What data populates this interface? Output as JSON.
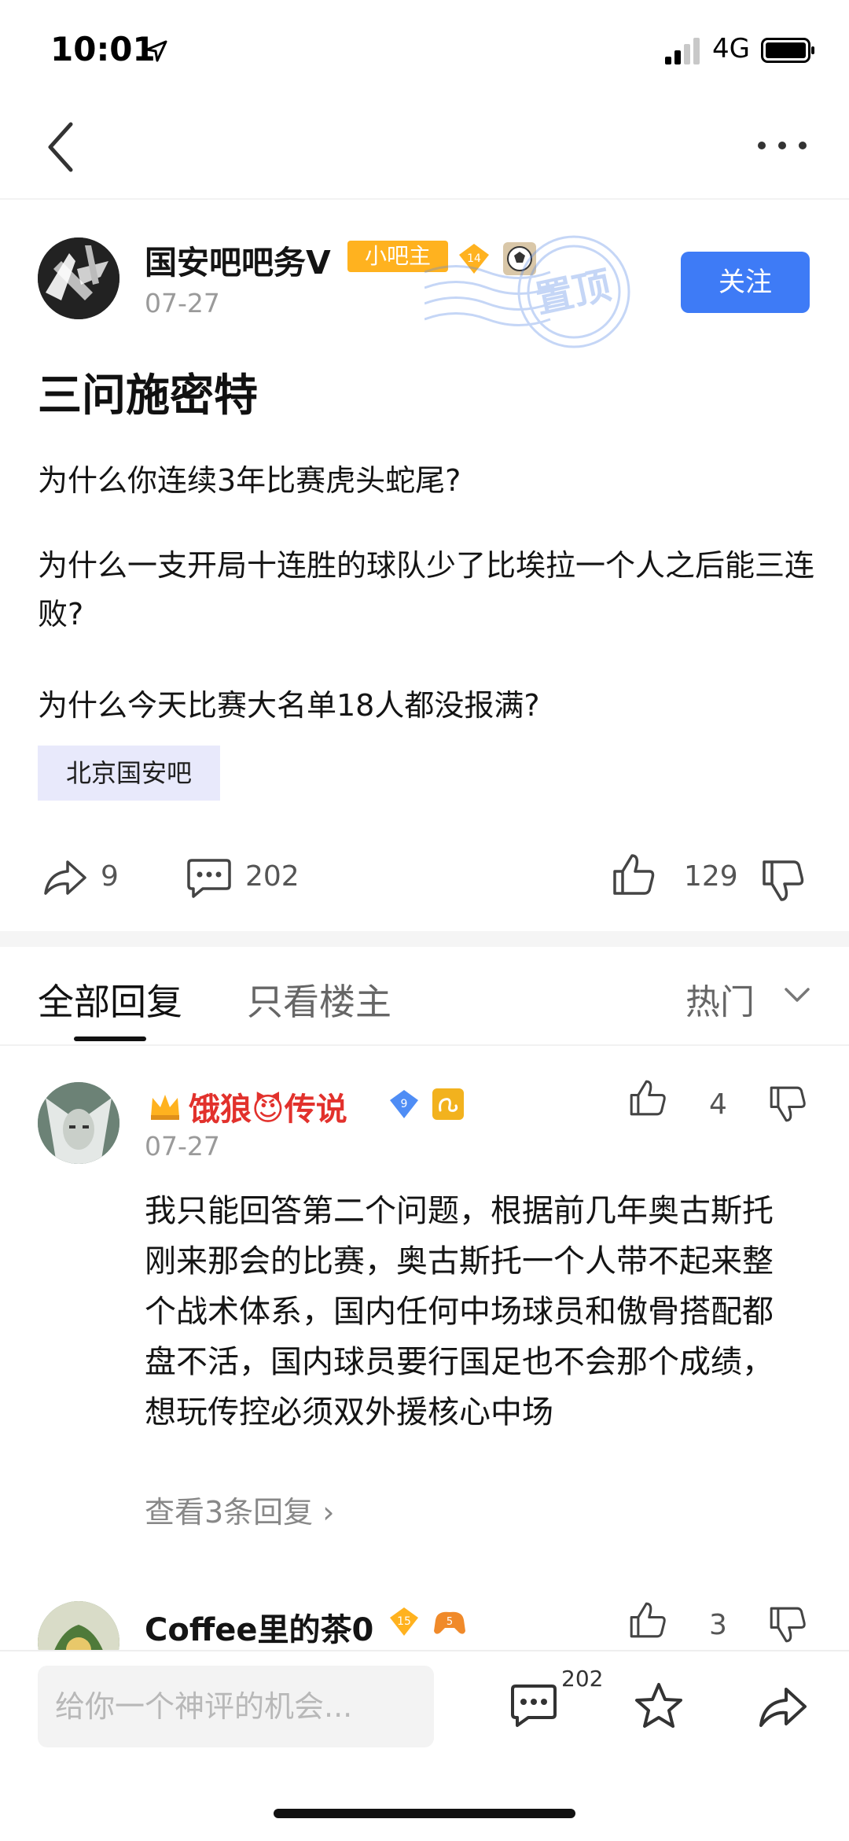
{
  "status_bar": {
    "time": "10:01",
    "network": "4G"
  },
  "post": {
    "author": "国安吧吧务V",
    "role_badge": "小吧主",
    "level": "14",
    "date": "07-27",
    "stamp_text": "置顶",
    "follow_label": "关注",
    "title": "三问施密特",
    "paragraphs": [
      "为什么你连续3年比赛虎头蛇尾?",
      "为什么一支开局十连胜的球队少了比埃拉一个人之后能三连败?",
      "为什么今天比赛大名单18人都没报满?"
    ],
    "tag": "北京国安吧",
    "share_count": "9",
    "comment_count": "202",
    "like_count": "129"
  },
  "tabs": {
    "all": "全部回复",
    "op_only": "只看楼主",
    "sort": "热门"
  },
  "comments": [
    {
      "author": "饿狼😈传说",
      "level": "9",
      "date": "07-27",
      "like_count": "4",
      "body": "我只能回答第二个问题，根据前几年奥古斯托刚来那会的比赛，奥古斯托一个人带不起来整个战术体系，国内任何中场球员和傲骨搭配都盘不活，国内球员要行国足也不会那个成绩，想玩传控必须双外援核心中场",
      "view_replies": "查看3条回复"
    },
    {
      "author": "Coffee里的茶0",
      "level": "15",
      "level2": "5",
      "like_count": "3"
    }
  ],
  "bottom_bar": {
    "placeholder": "给你一个神评的机会...",
    "comment_count": "202"
  },
  "colors": {
    "accent": "#3e7bf6",
    "badge_gold": "#ffb21f",
    "vip_red": "#e2312c"
  }
}
